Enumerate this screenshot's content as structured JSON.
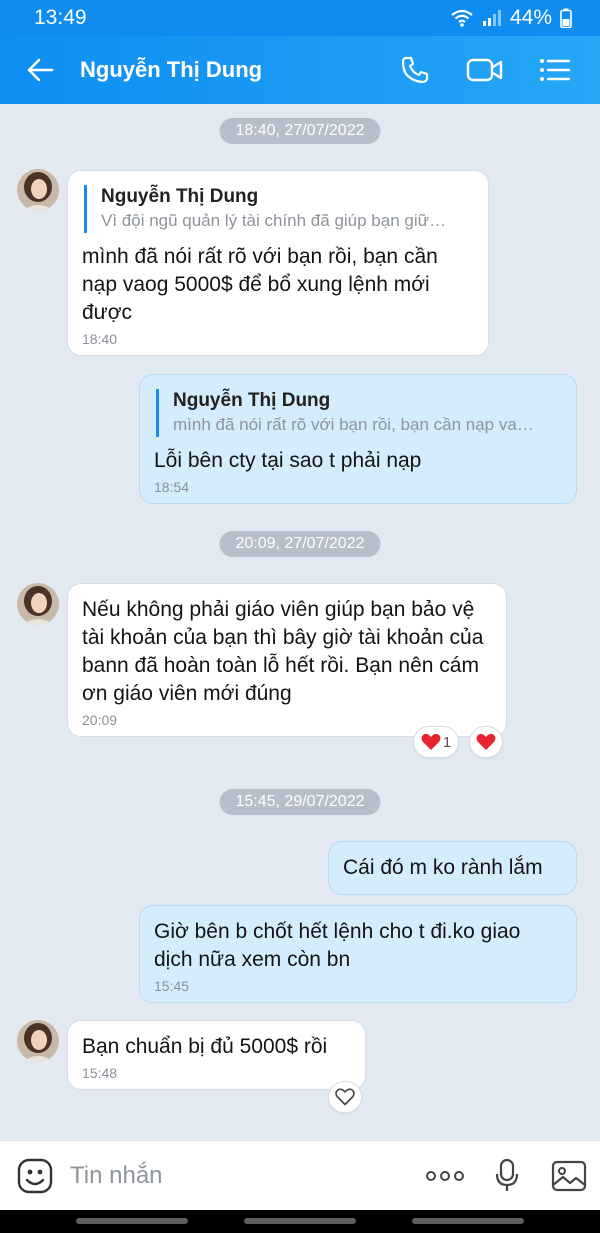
{
  "status_bar": {
    "time": "13:49",
    "battery": "44%"
  },
  "header": {
    "contact_name": "Nguyễn Thị Dung"
  },
  "conversation": {
    "date_separators": [
      "18:40, 27/07/2022",
      "20:09, 27/07/2022",
      "15:45, 29/07/2022"
    ],
    "messages": [
      {
        "sender": "contact",
        "quote": {
          "name": "Nguyễn Thị Dung",
          "text": "Vì đội ngũ quản lý tài chính đã giúp bạn giữ…"
        },
        "text": "mình đã nói rất rõ với bạn rồi, bạn cần nạp vaog 5000$ để bổ xung lệnh mới được",
        "time": "18:40"
      },
      {
        "sender": "me",
        "quote": {
          "name": "Nguyễn Thị Dung",
          "text": "mình đã nói rất rõ với bạn rồi, bạn cần nạp va…"
        },
        "text": "Lỗi bên cty tại sao t phải nạp",
        "time": "18:54"
      },
      {
        "sender": "contact",
        "text": "Nếu không phải giáo viên giúp bạn bảo vệ tài khoản của bạn thì bây giờ tài khoản của bann đã hoàn toàn lỗ hết rồi. Bạn nên cám ơn giáo viên mới đúng",
        "time": "20:09",
        "reaction_count": "1"
      },
      {
        "sender": "me",
        "text": "Cái đó m ko rành lắm"
      },
      {
        "sender": "me",
        "text": "Giờ bên b chốt hết lệnh cho t đi.ko giao dịch nữa xem còn bn",
        "time": "15:45"
      },
      {
        "sender": "contact",
        "text": "Bạn chuẩn bị đủ 5000$ rồi",
        "time": "15:48"
      }
    ]
  },
  "composer": {
    "placeholder": "Tin nhắn"
  },
  "colors": {
    "header_blue": "#0e8ef1",
    "my_bubble": "#d5ecfd",
    "background": "#e2e9f1",
    "heart": "#e8222e"
  },
  "icons": [
    "back-arrow-icon",
    "phone-icon",
    "video-call-icon",
    "menu-icon",
    "sticker-icon",
    "more-icon",
    "microphone-icon",
    "image-icon",
    "heart-icon",
    "heart-outline-icon"
  ]
}
